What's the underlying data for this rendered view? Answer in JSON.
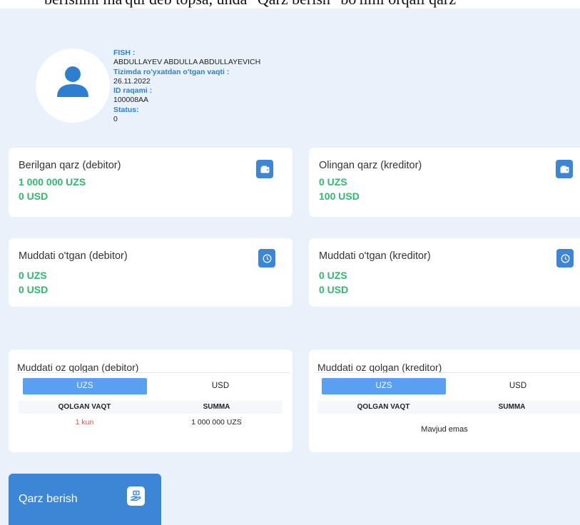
{
  "top_text": "berishini ma'qul deb topsa, unda \"Qarz berish\" bo'limi orqali qarz",
  "profile": {
    "fish_label": "FISH :",
    "fish_value": "ABDULLAYEV ABDULLA ABDULLAYEVICH",
    "reg_label": "Tizimda ro'yxatdan o'tgan vaqti :",
    "reg_value": "26.11.2022",
    "id_label": "ID raqami :",
    "id_value": "100008AA",
    "status_label": "Status:",
    "status_value": "0"
  },
  "cards": {
    "berilgan": {
      "title": "Berilgan qarz (debitor)",
      "uzs": "1 000 000 UZS",
      "usd": "0 USD",
      "icon": "wallet-icon"
    },
    "olingan": {
      "title": "Olingan qarz (kreditor)",
      "uzs": "0 UZS",
      "usd": "100 USD",
      "icon": "wallet-icon"
    },
    "overdue_debitor": {
      "title": "Muddati o'tgan (debitor)",
      "uzs": "0 UZS",
      "usd": "0 USD",
      "icon": "clock-icon"
    },
    "overdue_kreditor": {
      "title": "Muddati o'tgan (kreditor)",
      "uzs": "0 UZS",
      "usd": "0 USD",
      "icon": "clock-icon"
    }
  },
  "soon_debitor": {
    "title": "Muddati oz qolgan (debitor)",
    "tab_uzs": "UZS",
    "tab_usd": "USD",
    "col_time": "QOLGAN VAQT",
    "col_sum": "SUMMA",
    "rows": [
      {
        "time": "1 kun",
        "sum": "1 000 000 UZS"
      }
    ]
  },
  "soon_kreditor": {
    "title": "Muddati oz qolgan (kreditor)",
    "tab_uzs": "UZS",
    "tab_usd": "USD",
    "col_time": "QOLGAN VAQT",
    "col_sum": "SUMMA",
    "empty_text": "Mavjud emas"
  },
  "action_button": {
    "label": "Qarz berish",
    "icon": "hand-money-icon"
  },
  "colors": {
    "accent": "#3d86d6",
    "tab_active": "#5aa0f2",
    "amount_green": "#2fb86e",
    "label_blue": "#2f7fd1",
    "overdue_red": "#e05050",
    "background": "#e9f1fb"
  }
}
